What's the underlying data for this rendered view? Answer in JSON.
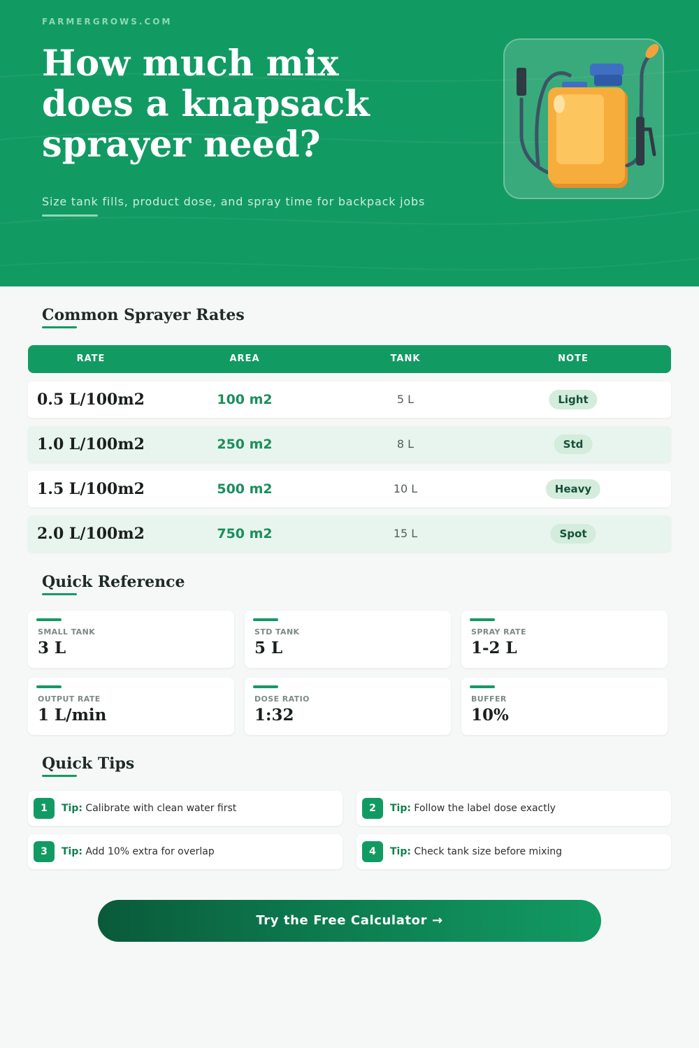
{
  "header": {
    "site": "FARMERGROWS.COM",
    "title": "How much mix does a knapsack sprayer need?",
    "subtitle": "Size tank fills, product dose, and spray time for backpack jobs",
    "image_icon": "knapsack-sprayer-icon"
  },
  "rates": {
    "title": "Common Sprayer Rates",
    "columns": [
      "RATE",
      "AREA",
      "TANK",
      "NOTE"
    ],
    "rows": [
      {
        "rate": "0.5 L/100m2",
        "area": "100 m2",
        "tank": "5 L",
        "note": "Light"
      },
      {
        "rate": "1.0 L/100m2",
        "area": "250 m2",
        "tank": "8 L",
        "note": "Std"
      },
      {
        "rate": "1.5 L/100m2",
        "area": "500 m2",
        "tank": "10 L",
        "note": "Heavy"
      },
      {
        "rate": "2.0 L/100m2",
        "area": "750 m2",
        "tank": "15 L",
        "note": "Spot"
      }
    ]
  },
  "reference": {
    "title": "Quick Reference",
    "cards": [
      {
        "label": "SMALL TANK",
        "value": "3 L"
      },
      {
        "label": "STD TANK",
        "value": "5 L"
      },
      {
        "label": "SPRAY RATE",
        "value": "1-2 L"
      },
      {
        "label": "OUTPUT RATE",
        "value": "1 L/min"
      },
      {
        "label": "DOSE RATIO",
        "value": "1:32"
      },
      {
        "label": "BUFFER",
        "value": "10%"
      }
    ]
  },
  "tips": {
    "title": "Quick Tips",
    "prefix": "Tip:",
    "items": [
      {
        "num": "1",
        "text": "Calibrate with clean water first"
      },
      {
        "num": "2",
        "text": "Follow the label dose exactly"
      },
      {
        "num": "3",
        "text": "Add 10% extra for overlap"
      },
      {
        "num": "4",
        "text": "Check tank size before mixing"
      }
    ]
  },
  "cta": {
    "label": "Try the Free Calculator →"
  },
  "colors": {
    "brand_green": "#129a63",
    "dark_green": "#0a5a3a",
    "tank_orange": "#f7ad3c",
    "cap_blue": "#3f6fc2"
  }
}
